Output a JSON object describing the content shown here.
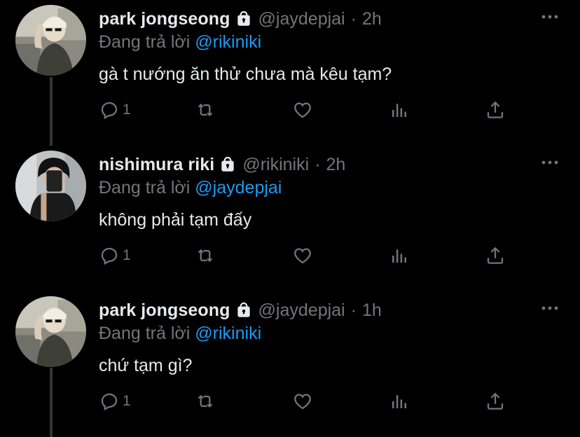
{
  "colors": {
    "background": "#000000",
    "text": "#e7e9ea",
    "muted": "#71767b",
    "link": "#1d9bf0",
    "thread_line": "#333639"
  },
  "tweets": [
    {
      "name": "park jongseong",
      "handle": "@jaydepjai",
      "separator": "·",
      "time": "2h",
      "replying_prefix": "Đang trả lời",
      "replying_to": "@rikiniki",
      "text": "gà t nướng ăn thử chưa mà kêu tạm?",
      "reply_count": "1",
      "avatar": "avatar-photo-blond"
    },
    {
      "name": "nishimura riki",
      "handle": "@rikiniki",
      "separator": "·",
      "time": "2h",
      "replying_prefix": "Đang trả lời",
      "replying_to": "@jaydepjai",
      "text": "không phải tạm đấy",
      "reply_count": "1",
      "avatar": "avatar-photo-dark"
    },
    {
      "name": "park jongseong",
      "handle": "@jaydepjai",
      "separator": "·",
      "time": "1h",
      "replying_prefix": "Đang trả lời",
      "replying_to": "@rikiniki",
      "text": "chứ tạm gì?",
      "reply_count": "1",
      "avatar": "avatar-photo-blond"
    }
  ],
  "icons": [
    "lock-icon",
    "more-icon",
    "reply-icon",
    "retweet-icon",
    "like-icon",
    "analytics-icon",
    "share-icon"
  ]
}
